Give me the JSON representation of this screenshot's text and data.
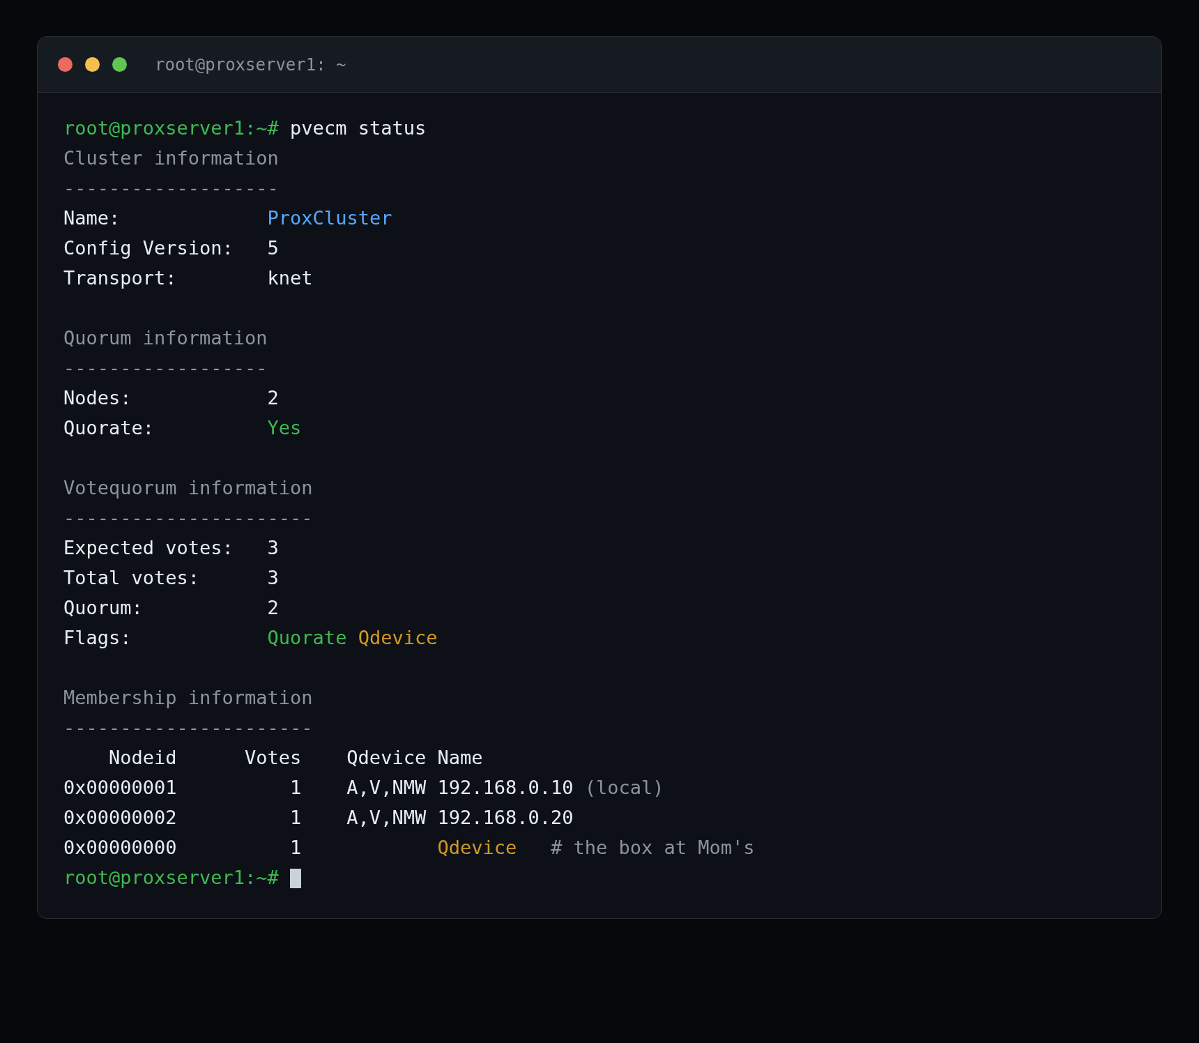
{
  "window": {
    "title": "root@proxserver1: ~"
  },
  "lines": [
    {
      "kind": "prompt",
      "prompt": "root@proxserver1:~#",
      "command": "pvecm status",
      "cursor": false
    },
    {
      "kind": "heading",
      "text": "Cluster information"
    },
    {
      "kind": "rule",
      "text": "-------------------"
    },
    {
      "kind": "field",
      "label": "Name:",
      "values": [
        {
          "text": "ProxCluster",
          "color": "#58a6ff"
        }
      ]
    },
    {
      "kind": "field",
      "label": "Config Version:",
      "values": [
        {
          "text": "5",
          "color": "#e6edf3"
        }
      ]
    },
    {
      "kind": "field",
      "label": "Transport:",
      "values": [
        {
          "text": "knet",
          "color": "#e6edf3"
        }
      ]
    },
    {
      "kind": "blank"
    },
    {
      "kind": "heading",
      "text": "Quorum information"
    },
    {
      "kind": "rule",
      "text": "------------------"
    },
    {
      "kind": "field",
      "label": "Nodes:",
      "values": [
        {
          "text": "2",
          "color": "#e6edf3"
        }
      ]
    },
    {
      "kind": "field",
      "label": "Quorate:",
      "values": [
        {
          "text": "Yes",
          "color": "#3fb950"
        }
      ]
    },
    {
      "kind": "blank"
    },
    {
      "kind": "heading",
      "text": "Votequorum information"
    },
    {
      "kind": "rule",
      "text": "----------------------"
    },
    {
      "kind": "field",
      "label": "Expected votes:",
      "values": [
        {
          "text": "3",
          "color": "#e6edf3"
        }
      ]
    },
    {
      "kind": "field",
      "label": "Total votes:",
      "values": [
        {
          "text": "3",
          "color": "#e6edf3"
        }
      ]
    },
    {
      "kind": "field",
      "label": "Quorum:",
      "values": [
        {
          "text": "2",
          "color": "#e6edf3"
        }
      ]
    },
    {
      "kind": "field",
      "label": "Flags:",
      "values": [
        {
          "text": "Quorate",
          "color": "#3fb950"
        },
        {
          "text": "Qdevice",
          "color": "#d29922"
        }
      ]
    },
    {
      "kind": "blank"
    },
    {
      "kind": "heading",
      "text": "Membership information"
    },
    {
      "kind": "rule",
      "text": "----------------------"
    },
    {
      "kind": "table",
      "columns": [
        "Nodeid",
        "Votes",
        "Qdevice",
        "Name"
      ],
      "rows": [
        {
          "nodeid": "0x00000001",
          "votes": "1",
          "qdevice": "A,V,NMW",
          "name": "192.168.0.10",
          "color": "#e6edf3",
          "note": {
            "kind": "local",
            "text": "(local)"
          }
        },
        {
          "nodeid": "0x00000002",
          "votes": "1",
          "qdevice": "A,V,NMW",
          "name": "192.168.0.20",
          "color": "#e6edf3"
        },
        {
          "nodeid": "0x00000000",
          "votes": "1",
          "name": "Qdevice",
          "color": "#d29922",
          "note": {
            "kind": "comment",
            "text": "# the box at Mom's"
          }
        }
      ]
    },
    {
      "kind": "prompt",
      "prompt": "root@proxserver1:~#",
      "cursor": true
    }
  ]
}
